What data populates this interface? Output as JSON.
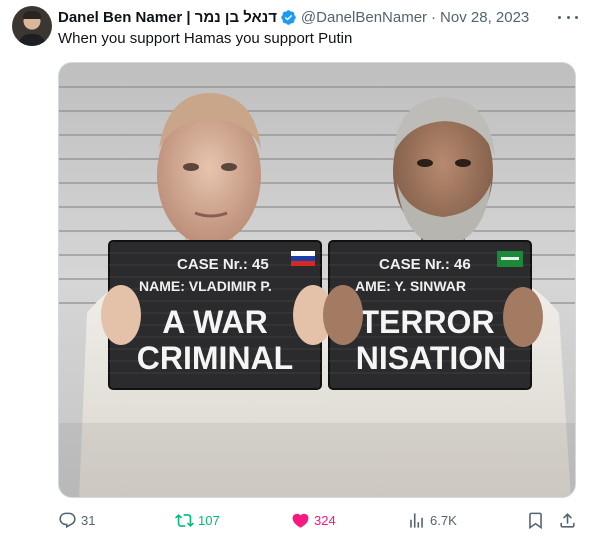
{
  "tweet": {
    "display_name": "Danel Ben Namer | דנאל בן נמר",
    "handle": "@DanelBenNamer",
    "separator": "·",
    "date": "Nov 28, 2023",
    "text": "When you support Hamas you support Putin",
    "verified": true
  },
  "media": {
    "left_sign": {
      "case": "CASE Nr.: 45",
      "name": "NAME: VLADIMIR P.",
      "line1": "A WAR",
      "line2": "CRIMINAL",
      "flag": "russia-flag"
    },
    "right_sign": {
      "case": "CASE Nr.: 46",
      "name": "AME: Y. SINWAR",
      "line1": "TERROR",
      "line2": "NISATION",
      "flag": "hamas-flag"
    },
    "background_color": "#cfcfcf",
    "sign_color": "#2b2b2d"
  },
  "actions": {
    "replies": "31",
    "retweets": "107",
    "likes": "324",
    "views": "6.7K"
  },
  "colors": {
    "text_primary": "#0f1419",
    "text_secondary": "#536471",
    "verified_blue": "#1d9bf0",
    "retweet_green": "#00ba7c",
    "like_pink": "#f91880"
  },
  "icons": [
    "verified-badge-icon",
    "more-icon",
    "reply-icon",
    "retweet-icon",
    "like-icon",
    "views-icon",
    "bookmark-icon",
    "share-icon"
  ]
}
